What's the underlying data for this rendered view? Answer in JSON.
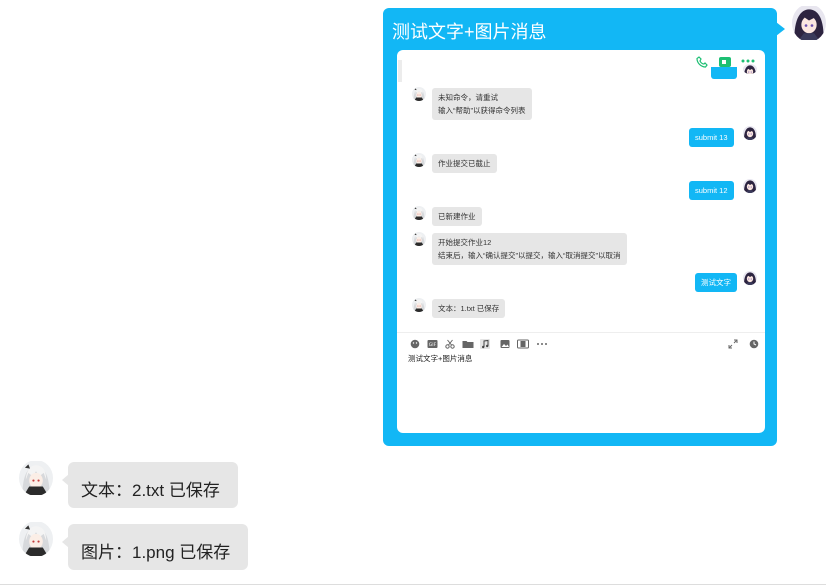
{
  "outer_message": {
    "title": "测试文字+图片消息"
  },
  "inner_chat": {
    "header_icons": [
      "phone-icon",
      "video-call-icon",
      "more-icon"
    ],
    "messages": [
      {
        "from": "bot",
        "lines": [
          "未知命令，请重试",
          "输入“帮助”以获得命令列表"
        ]
      },
      {
        "from": "user",
        "text": "submit 13"
      },
      {
        "from": "bot",
        "lines": [
          "作业提交已截止"
        ]
      },
      {
        "from": "user",
        "text": "submit 12"
      },
      {
        "from": "bot",
        "lines": [
          "已新建作业"
        ]
      },
      {
        "from": "bot",
        "lines": [
          "开始提交作业12",
          "结束后，输入“确认提交”以提交，输入“取消提交”以取消"
        ]
      },
      {
        "from": "user",
        "text": "测试文字"
      },
      {
        "from": "bot",
        "lines": [
          "文本：1.txt 已保存"
        ]
      }
    ],
    "toolbar_icons": [
      "emoji-icon",
      "gif-icon",
      "scissors-icon",
      "folder-icon",
      "music-icon",
      "image-icon",
      "phone-frame-icon",
      "more-icon"
    ],
    "toolbar_right_icons": [
      "expand-icon",
      "history-icon"
    ],
    "input_text": "测试文字+图片消息"
  },
  "outer_messages": [
    {
      "text": "文本：2.txt 已保存"
    },
    {
      "text": "图片：1.png 已保存"
    }
  ],
  "colors": {
    "accent": "#12b7f5",
    "bubble_gray": "#e6e6e6",
    "call_green": "#1dbf73"
  }
}
